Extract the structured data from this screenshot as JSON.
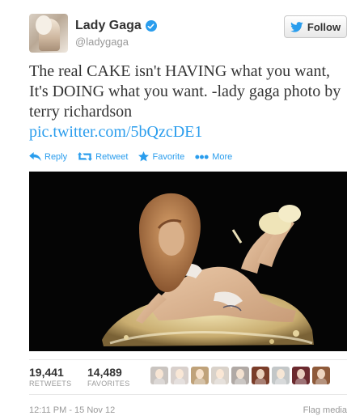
{
  "user": {
    "display_name": "Lady Gaga",
    "handle": "@ladygaga",
    "verified": true
  },
  "follow_button": {
    "label": "Follow",
    "icon": "twitter-bird-icon"
  },
  "tweet": {
    "text": "The real CAKE isn't HAVING what you want, It's DOING what you want. -lady gaga photo by terry richardson",
    "link": "pic.twitter.com/5bQzcDE1"
  },
  "actions": [
    {
      "label": "Reply",
      "icon": "reply-icon"
    },
    {
      "label": "Retweet",
      "icon": "retweet-icon"
    },
    {
      "label": "Favorite",
      "icon": "star-icon"
    },
    {
      "label": "More",
      "icon": "more-dots-icon"
    }
  ],
  "stats": {
    "retweets": {
      "count": "19,441",
      "label": "RETWEETS"
    },
    "favorites": {
      "count": "14,489",
      "label": "FAVORITES"
    }
  },
  "favoriter_avatars": [
    "#c9c4c0",
    "#d8d0cc",
    "#bfa27a",
    "#d9d2ca",
    "#b0a9a5",
    "#7a3d2a",
    "#c3c7c8",
    "#6b2a2e",
    "#8e5a3a"
  ],
  "footer": {
    "timestamp": "12:11 PM - 15 Nov 12",
    "flag_label": "Flag media"
  },
  "colors": {
    "link": "#2a9ded",
    "muted": "#999999",
    "text": "#333333"
  }
}
